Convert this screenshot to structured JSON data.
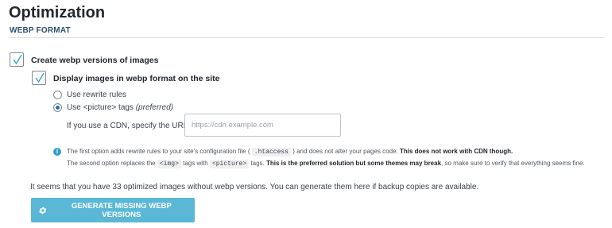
{
  "page": {
    "title": "Optimization",
    "section": "WEBP FORMAT"
  },
  "webp": {
    "create_label": "Create webp versions of images",
    "create_checked": true,
    "display_label": "Display images in webp format on the site",
    "display_checked": true,
    "radio_rewrite_label": "Use rewrite rules",
    "radio_picture_label": "Use <picture> tags",
    "radio_picture_suffix": "(preferred)",
    "selected_radio": "picture",
    "cdn_label": "If you use a CDN, specify the URL:",
    "cdn_placeholder": "https://cdn.example.com",
    "cdn_value": ""
  },
  "note": {
    "line1_a": "The first option adds rewrite rules to your site's configuration file (",
    "line1_code": ".htaccess",
    "line1_b": ") and does not alter your pages code.",
    "line1_bold": "This does not work with CDN though.",
    "line2_a": "The second option replaces the",
    "line2_code1": "<img>",
    "line2_b": "tags with",
    "line2_code2": "<picture>",
    "line2_c": "tags.",
    "line2_bold": "This is the preferred solution but some themes may break",
    "line2_d": ", so make sure to verify that everything seems fine."
  },
  "summary": "It seems that you have 33 optimized images without webp versions. You can generate them here if backup copies are available.",
  "generate_button": "GENERATE MISSING WEBP VERSIONS",
  "icons": {
    "checkmark": "checkmark-icon",
    "info": "info-icon",
    "gear": "gear-icon"
  },
  "colors": {
    "button_bg": "#5ab8d6",
    "info_icon": "#2f9fcf",
    "radio_selected": "#2271b1",
    "check": "#2f9fcf"
  }
}
